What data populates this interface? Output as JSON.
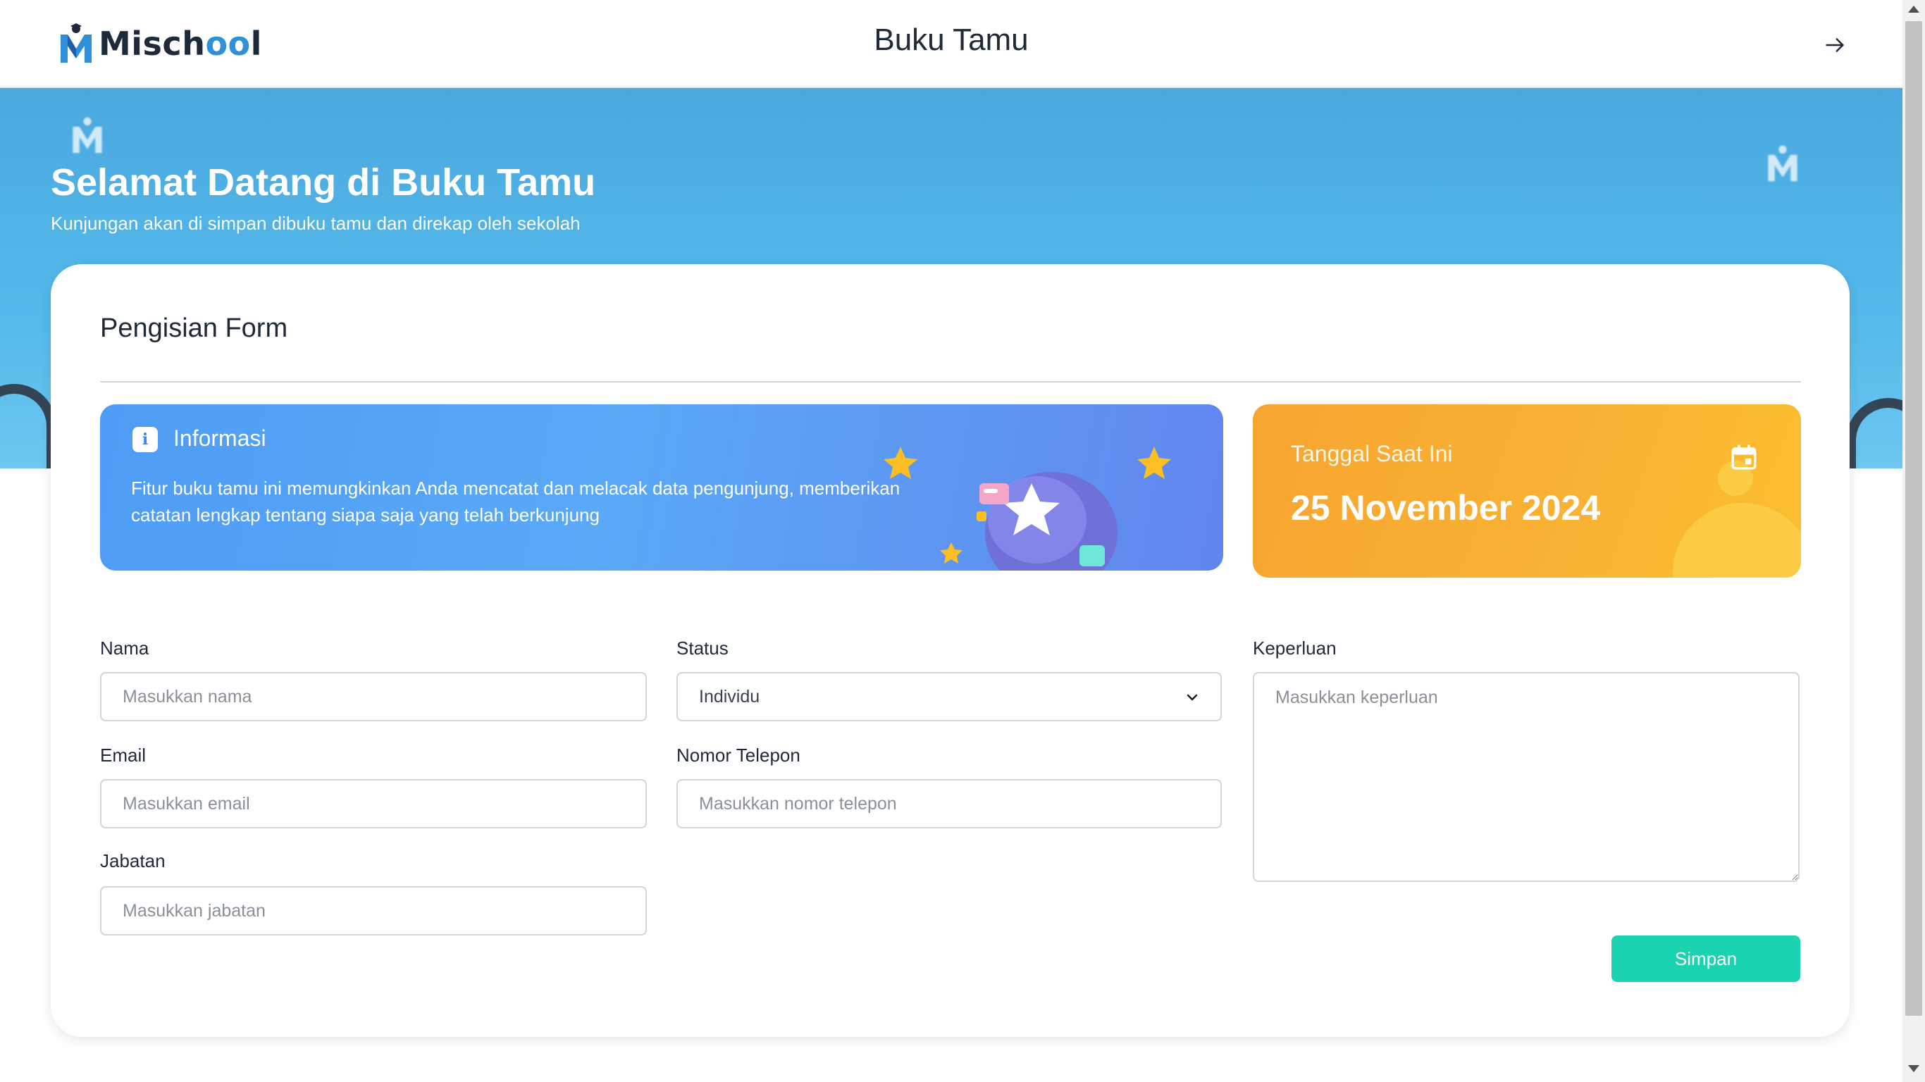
{
  "app": {
    "logo_text_dark": "Misch",
    "logo_text_blue": "oo",
    "logo_text_end": "l",
    "page_title": "Buku Tamu",
    "logout_icon": "arrow-right-icon"
  },
  "hero": {
    "title": "Selamat Datang di Buku Tamu",
    "subtitle": "Kunjungan akan di simpan dibuku tamu dan direkap oleh sekolah"
  },
  "form": {
    "title": "Pengisian Form",
    "info": {
      "icon": "info-icon",
      "title": "Informasi",
      "text": "Fitur buku tamu ini memungkinkan Anda mencatat dan melacak data pengunjung, memberikan catatan lengkap tentang siapa saja yang telah berkunjung"
    },
    "date": {
      "label": "Tanggal Saat Ini",
      "value": "25 November 2024",
      "icon": "calendar-icon"
    },
    "fields": {
      "nama": {
        "label": "Nama",
        "placeholder": "Masukkan nama",
        "value": ""
      },
      "email": {
        "label": "Email",
        "placeholder": "Masukkan email",
        "value": ""
      },
      "jabatan": {
        "label": "Jabatan",
        "placeholder": "Masukkan jabatan",
        "value": ""
      },
      "status": {
        "label": "Status",
        "selected": "Individu"
      },
      "telepon": {
        "label": "Nomor Telepon",
        "placeholder": "Masukkan nomor telepon",
        "value": ""
      },
      "keperluan": {
        "label": "Keperluan",
        "placeholder": "Masukkan keperluan",
        "value": ""
      }
    },
    "submit_label": "Simpan"
  },
  "colors": {
    "hero_blue": "#55b9ea",
    "info_blue": "#5aa9f7",
    "date_orange": "#f9b233",
    "submit_teal": "#1bd3b0"
  }
}
